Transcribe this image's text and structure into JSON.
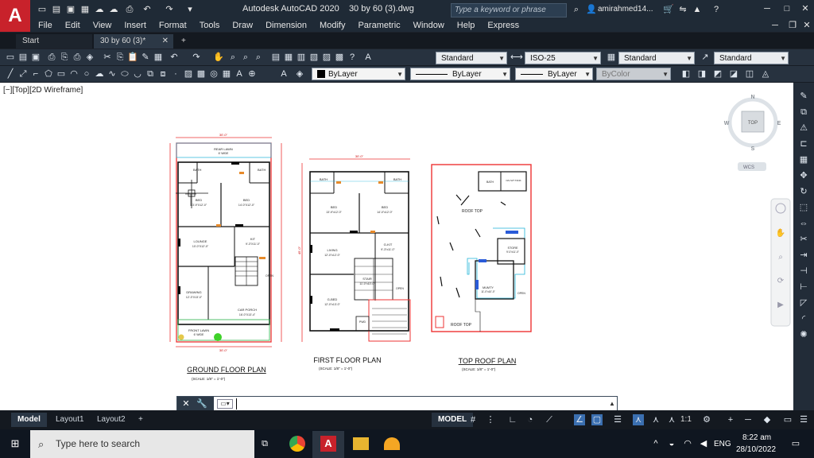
{
  "window": {
    "title": "Autodesk AutoCAD 2020",
    "file": "30 by 60 (3).dwg",
    "search_placeholder": "Type a keyword or phrase",
    "user": "amirahmed14...",
    "menus": [
      "File",
      "Edit",
      "View",
      "Insert",
      "Format",
      "Tools",
      "Draw",
      "Dimension",
      "Modify",
      "Parametric",
      "Window",
      "Help",
      "Express"
    ]
  },
  "tabs": [
    {
      "label": "Start"
    },
    {
      "label": "30 by 60 (3)*"
    }
  ],
  "toolbars": {
    "text_style": "Standard",
    "dim_style": "ISO-25",
    "table_style": "Standard",
    "multileader_style": "Standard",
    "layer": "ByLayer",
    "linetype": "ByLayer",
    "lineweight": "ByLayer",
    "plot_style": "ByColor"
  },
  "viewport": {
    "label": "[−][Top][2D Wireframe]",
    "viewcube": {
      "n": "N",
      "s": "S",
      "e": "E",
      "w": "W",
      "face": "TOP",
      "wcs": "WCS"
    }
  },
  "drawing": {
    "ground_floor_title": "GROUND FLOOR PLAN",
    "ground_floor_scale": "(SCALE: 1/8\" = 1'-0\")",
    "first_floor_title": "FIRST FLOOR PLAN",
    "first_floor_scale": "(SCALE: 1/8\" = 1'-0\")",
    "roof_title": "TOP ROOF PLAN",
    "roof_scale": "(SCALE: 1/8\" = 1'-0\")",
    "gf_rooms": {
      "rear_lawn": "REAR LAWN",
      "rear_lawn_w": "6' WIDE",
      "bath1": "BATH",
      "bath2": "BATH",
      "bed1": "BED",
      "bed1_size": "13'-9\"X12'-0\"",
      "bed2": "BED",
      "bed2_size": "14'-0\"X12'-0\"",
      "lounge": "LOUNGE",
      "lounge_size": "10'-0\"X12'-0\"",
      "kit": "KIT",
      "kit_size": "9'-3\"X11'-0\"",
      "drawing": "DRAWING",
      "drawing_size": "12'-3\"X13'-0\"",
      "car_porch": "CAR PORCH",
      "car_porch_size": "16'-0\"X13'-4\"",
      "front_lawn": "FRONT LAWN",
      "front_lawn_w": "6' WIDE",
      "open": "OPEN",
      "dim_top": "30'-0\"",
      "dim_bottom": "30'-0\""
    },
    "ff_rooms": {
      "bath1": "BATH",
      "bath2": "BATH",
      "bed1": "BED",
      "bed1_size": "13'-9\"x12'-0\"",
      "bed2": "BED",
      "bed2_size": "14'-0\"x12'-0\"",
      "living": "LIVING",
      "living_size": "12'-0\"x12'-0\"",
      "gkit": "G-KIT",
      "gkit_size": "9'-3\"x11'-0\"",
      "stair": "STAIR",
      "stair_size": "11'-0\"x10'-0\"",
      "gbed": "G-BED",
      "gbed_size": "12'-0\"x13'-0\"",
      "pwd": "PWD",
      "open": "OPEN",
      "dim_top": "30'-0\"",
      "dim_side": "45'-0\""
    },
    "roof_rooms": {
      "bath": "BATH",
      "tank": "O/H WT TANK",
      "roof_top1": "ROOF TOP",
      "roof_top2": "ROOF TOP",
      "store": "STORE",
      "store_size": "9'-0\"x11'-0\"",
      "mumty": "MUMTY",
      "mumty_size": "11'-0\"x10'-0\"",
      "open": "OPEN"
    }
  },
  "layout_tabs": [
    {
      "label": "Model"
    },
    {
      "label": "Layout1"
    },
    {
      "label": "Layout2"
    }
  ],
  "status": {
    "model": "MODEL",
    "scale": "1:1"
  },
  "taskbar": {
    "search": "Type here to search",
    "lang": "ENG",
    "time": "8:22 am",
    "date": "28/10/2022"
  }
}
